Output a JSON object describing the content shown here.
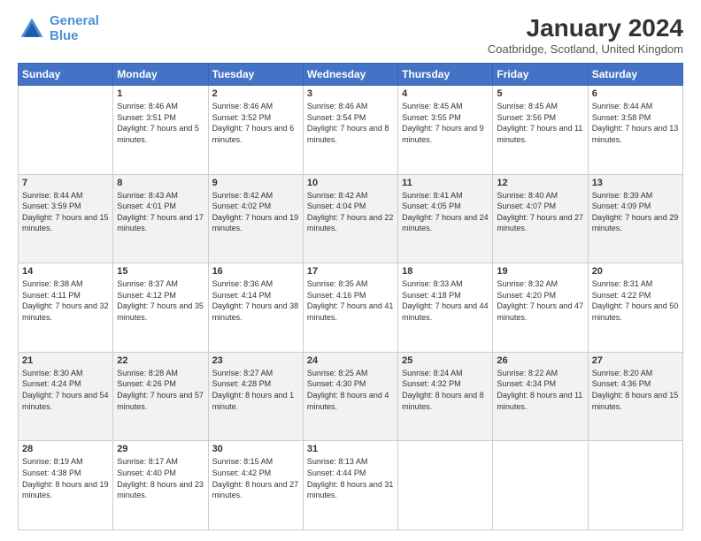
{
  "header": {
    "logo_line1": "General",
    "logo_line2": "Blue",
    "title": "January 2024",
    "location": "Coatbridge, Scotland, United Kingdom"
  },
  "days_of_week": [
    "Sunday",
    "Monday",
    "Tuesday",
    "Wednesday",
    "Thursday",
    "Friday",
    "Saturday"
  ],
  "weeks": [
    [
      {
        "day": "",
        "sunrise": "",
        "sunset": "",
        "daylight": ""
      },
      {
        "day": "1",
        "sunrise": "Sunrise: 8:46 AM",
        "sunset": "Sunset: 3:51 PM",
        "daylight": "Daylight: 7 hours and 5 minutes."
      },
      {
        "day": "2",
        "sunrise": "Sunrise: 8:46 AM",
        "sunset": "Sunset: 3:52 PM",
        "daylight": "Daylight: 7 hours and 6 minutes."
      },
      {
        "day": "3",
        "sunrise": "Sunrise: 8:46 AM",
        "sunset": "Sunset: 3:54 PM",
        "daylight": "Daylight: 7 hours and 8 minutes."
      },
      {
        "day": "4",
        "sunrise": "Sunrise: 8:45 AM",
        "sunset": "Sunset: 3:55 PM",
        "daylight": "Daylight: 7 hours and 9 minutes."
      },
      {
        "day": "5",
        "sunrise": "Sunrise: 8:45 AM",
        "sunset": "Sunset: 3:56 PM",
        "daylight": "Daylight: 7 hours and 11 minutes."
      },
      {
        "day": "6",
        "sunrise": "Sunrise: 8:44 AM",
        "sunset": "Sunset: 3:58 PM",
        "daylight": "Daylight: 7 hours and 13 minutes."
      }
    ],
    [
      {
        "day": "7",
        "sunrise": "Sunrise: 8:44 AM",
        "sunset": "Sunset: 3:59 PM",
        "daylight": "Daylight: 7 hours and 15 minutes."
      },
      {
        "day": "8",
        "sunrise": "Sunrise: 8:43 AM",
        "sunset": "Sunset: 4:01 PM",
        "daylight": "Daylight: 7 hours and 17 minutes."
      },
      {
        "day": "9",
        "sunrise": "Sunrise: 8:42 AM",
        "sunset": "Sunset: 4:02 PM",
        "daylight": "Daylight: 7 hours and 19 minutes."
      },
      {
        "day": "10",
        "sunrise": "Sunrise: 8:42 AM",
        "sunset": "Sunset: 4:04 PM",
        "daylight": "Daylight: 7 hours and 22 minutes."
      },
      {
        "day": "11",
        "sunrise": "Sunrise: 8:41 AM",
        "sunset": "Sunset: 4:05 PM",
        "daylight": "Daylight: 7 hours and 24 minutes."
      },
      {
        "day": "12",
        "sunrise": "Sunrise: 8:40 AM",
        "sunset": "Sunset: 4:07 PM",
        "daylight": "Daylight: 7 hours and 27 minutes."
      },
      {
        "day": "13",
        "sunrise": "Sunrise: 8:39 AM",
        "sunset": "Sunset: 4:09 PM",
        "daylight": "Daylight: 7 hours and 29 minutes."
      }
    ],
    [
      {
        "day": "14",
        "sunrise": "Sunrise: 8:38 AM",
        "sunset": "Sunset: 4:11 PM",
        "daylight": "Daylight: 7 hours and 32 minutes."
      },
      {
        "day": "15",
        "sunrise": "Sunrise: 8:37 AM",
        "sunset": "Sunset: 4:12 PM",
        "daylight": "Daylight: 7 hours and 35 minutes."
      },
      {
        "day": "16",
        "sunrise": "Sunrise: 8:36 AM",
        "sunset": "Sunset: 4:14 PM",
        "daylight": "Daylight: 7 hours and 38 minutes."
      },
      {
        "day": "17",
        "sunrise": "Sunrise: 8:35 AM",
        "sunset": "Sunset: 4:16 PM",
        "daylight": "Daylight: 7 hours and 41 minutes."
      },
      {
        "day": "18",
        "sunrise": "Sunrise: 8:33 AM",
        "sunset": "Sunset: 4:18 PM",
        "daylight": "Daylight: 7 hours and 44 minutes."
      },
      {
        "day": "19",
        "sunrise": "Sunrise: 8:32 AM",
        "sunset": "Sunset: 4:20 PM",
        "daylight": "Daylight: 7 hours and 47 minutes."
      },
      {
        "day": "20",
        "sunrise": "Sunrise: 8:31 AM",
        "sunset": "Sunset: 4:22 PM",
        "daylight": "Daylight: 7 hours and 50 minutes."
      }
    ],
    [
      {
        "day": "21",
        "sunrise": "Sunrise: 8:30 AM",
        "sunset": "Sunset: 4:24 PM",
        "daylight": "Daylight: 7 hours and 54 minutes."
      },
      {
        "day": "22",
        "sunrise": "Sunrise: 8:28 AM",
        "sunset": "Sunset: 4:26 PM",
        "daylight": "Daylight: 7 hours and 57 minutes."
      },
      {
        "day": "23",
        "sunrise": "Sunrise: 8:27 AM",
        "sunset": "Sunset: 4:28 PM",
        "daylight": "Daylight: 8 hours and 1 minute."
      },
      {
        "day": "24",
        "sunrise": "Sunrise: 8:25 AM",
        "sunset": "Sunset: 4:30 PM",
        "daylight": "Daylight: 8 hours and 4 minutes."
      },
      {
        "day": "25",
        "sunrise": "Sunrise: 8:24 AM",
        "sunset": "Sunset: 4:32 PM",
        "daylight": "Daylight: 8 hours and 8 minutes."
      },
      {
        "day": "26",
        "sunrise": "Sunrise: 8:22 AM",
        "sunset": "Sunset: 4:34 PM",
        "daylight": "Daylight: 8 hours and 11 minutes."
      },
      {
        "day": "27",
        "sunrise": "Sunrise: 8:20 AM",
        "sunset": "Sunset: 4:36 PM",
        "daylight": "Daylight: 8 hours and 15 minutes."
      }
    ],
    [
      {
        "day": "28",
        "sunrise": "Sunrise: 8:19 AM",
        "sunset": "Sunset: 4:38 PM",
        "daylight": "Daylight: 8 hours and 19 minutes."
      },
      {
        "day": "29",
        "sunrise": "Sunrise: 8:17 AM",
        "sunset": "Sunset: 4:40 PM",
        "daylight": "Daylight: 8 hours and 23 minutes."
      },
      {
        "day": "30",
        "sunrise": "Sunrise: 8:15 AM",
        "sunset": "Sunset: 4:42 PM",
        "daylight": "Daylight: 8 hours and 27 minutes."
      },
      {
        "day": "31",
        "sunrise": "Sunrise: 8:13 AM",
        "sunset": "Sunset: 4:44 PM",
        "daylight": "Daylight: 8 hours and 31 minutes."
      },
      {
        "day": "",
        "sunrise": "",
        "sunset": "",
        "daylight": ""
      },
      {
        "day": "",
        "sunrise": "",
        "sunset": "",
        "daylight": ""
      },
      {
        "day": "",
        "sunrise": "",
        "sunset": "",
        "daylight": ""
      }
    ]
  ]
}
